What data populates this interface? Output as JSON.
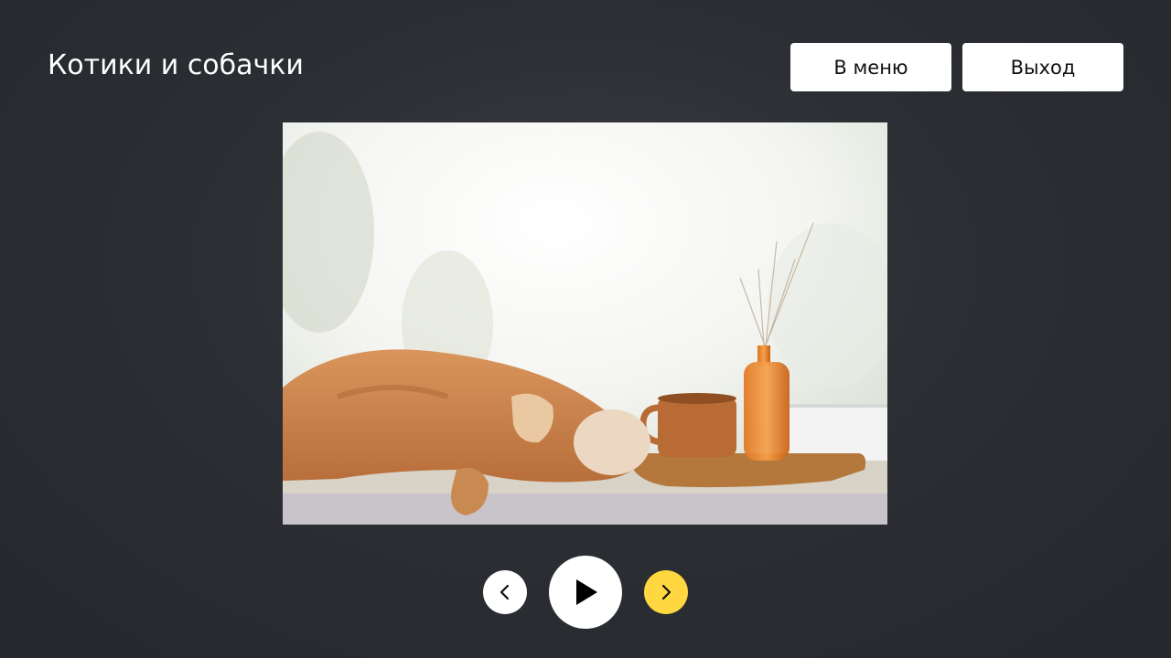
{
  "header": {
    "title": "Котики и собачки",
    "menu_button": "В меню",
    "exit_button": "Выход"
  },
  "slideshow": {
    "image_alt": "cat-photo",
    "controls": {
      "prev_icon": "chevron-left-icon",
      "play_icon": "play-icon",
      "next_icon": "chevron-right-icon"
    }
  },
  "colors": {
    "background": "#2b2e33",
    "button": "#ffffff",
    "accent": "#ffd740"
  }
}
